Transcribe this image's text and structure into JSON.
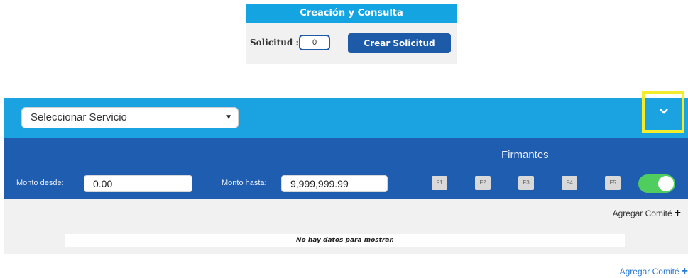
{
  "consulta": {
    "title": "Creación y Consulta",
    "solicitud_label": "Solicitud :",
    "solicitud_value": "0",
    "crear_button": "Crear Solicitud"
  },
  "service": {
    "select_value": "Seleccionar Servicio",
    "dropdown_glyph": "▼",
    "expand_icon": "chevron-down-icon"
  },
  "filters": {
    "firmantes_title": "Firmantes",
    "monto_desde_label": "Monto desde:",
    "monto_desde_value": "0.00",
    "monto_hasta_label": "Monto hasta:",
    "monto_hasta_value": "9,999,999.99",
    "firmantes": [
      "F1",
      "F2",
      "F3",
      "F4",
      "F5"
    ],
    "toggle_on": true,
    "toggle_color": "#4fcd5f"
  },
  "results": {
    "agregar_comite": "Agregar Comité",
    "empty_message": "No hay datos para mostrar.",
    "agregar_comite_bottom": "Agregar Comité"
  },
  "colors": {
    "primary_blue": "#1aa3e0",
    "dark_blue": "#1f5db1",
    "highlight_yellow": "#f2ec2c"
  }
}
